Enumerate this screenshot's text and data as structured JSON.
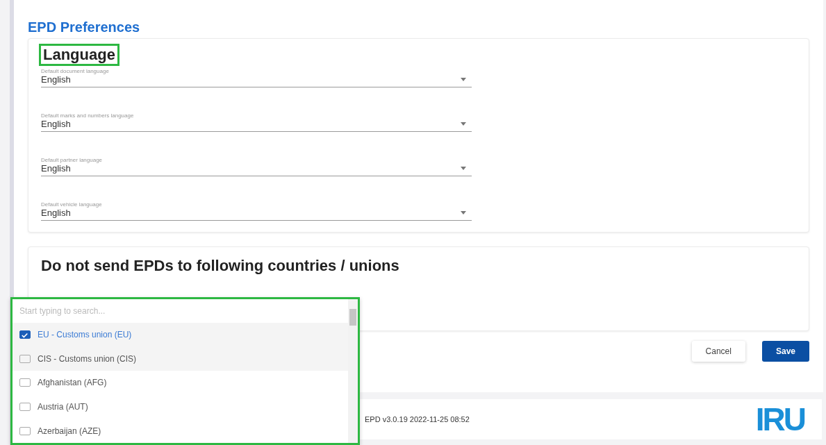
{
  "page_title": "EPD Preferences",
  "language_section": {
    "title": "Language",
    "highlighted": true,
    "fields": [
      {
        "label": "Default document language",
        "value": "English"
      },
      {
        "label": "Default marks and numbers language",
        "value": "English"
      },
      {
        "label": "Default partner language",
        "value": "English"
      },
      {
        "label": "Default vehicle language",
        "value": "English"
      }
    ]
  },
  "countries_section": {
    "title": "Do not send EPDs to following countries / unions"
  },
  "country_dropdown": {
    "highlighted": true,
    "placeholder": "Start typing to search...",
    "options": [
      {
        "label": "EU - Customs union (EU)",
        "checked": true
      },
      {
        "label": "CIS - Customs union (CIS)",
        "checked": false
      },
      {
        "label": "Afghanistan (AFG)",
        "checked": false
      },
      {
        "label": "Austria (AUT)",
        "checked": false
      },
      {
        "label": "Azerbaijan (AZE)",
        "checked": false
      }
    ]
  },
  "buttons": [
    {
      "label": "Cancel",
      "kind": "secondary"
    },
    {
      "label": "Save",
      "kind": "primary"
    }
  ],
  "footer": {
    "version": "EPD v3.0.19 2022-11-25 08:52",
    "logo": "IRU"
  }
}
